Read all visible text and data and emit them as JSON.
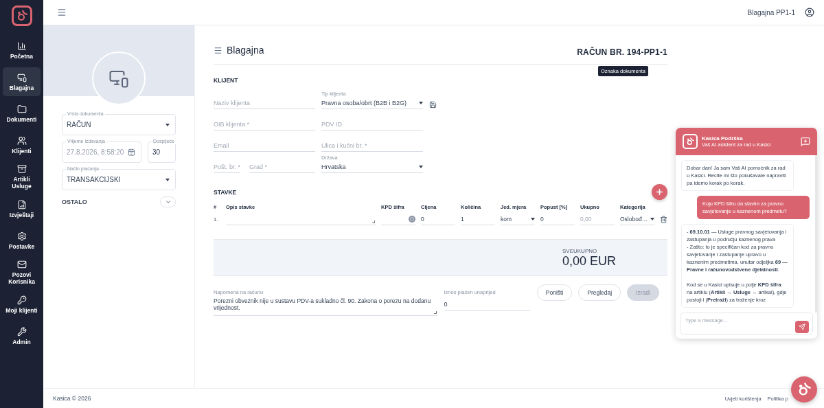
{
  "sidebar": {
    "items": [
      {
        "label": "Početna",
        "selected": false
      },
      {
        "label": "Blagajna",
        "selected": true
      },
      {
        "label": "Dokumenti",
        "selected": false
      },
      {
        "label": "Klijenti",
        "selected": false
      },
      {
        "label": "Artikli\nUsluge",
        "selected": false
      },
      {
        "label": "Izvještaji",
        "selected": false
      },
      {
        "label": "Postavke",
        "selected": false
      },
      {
        "label": "Pozovi\nKorisnika",
        "selected": false
      },
      {
        "label": "Moji klijenti",
        "selected": false
      },
      {
        "label": "Admin",
        "selected": false
      }
    ]
  },
  "top_bar": {
    "user": "Blagajna PP1-1"
  },
  "document_panel": {
    "document_type": {
      "label": "Vrsta dokumenta",
      "value": "RAČUN"
    },
    "issue_time": {
      "label": "Vrijeme izdavanja",
      "value": "27.8.2026, 8:58:20",
      "disabled": true
    },
    "due": {
      "label": "Dospijeće",
      "value": "30"
    },
    "payment_method": {
      "label": "Način plaćanja",
      "value": "TRANSAKCIJSKI"
    },
    "other": {
      "label": "OSTALO",
      "expanded": false
    }
  },
  "page": {
    "title": "Blagajna",
    "document_number": "RAČUN BR. 194-PP1-1",
    "tooltip": "Oznaka dokumenta"
  },
  "client": {
    "title": "KLIJENT",
    "rows": [
      {
        "left": [
          {
            "kind": "input",
            "placeholder": "Naziv klijenta"
          }
        ],
        "right": {
          "kind": "select",
          "label": "Tip klijenta",
          "value": "Pravna osoba/obrt (B2B i B2G)"
        }
      },
      {
        "left": [
          {
            "kind": "input",
            "placeholder": "OIB klijenta *"
          }
        ],
        "right": {
          "kind": "input",
          "placeholder": "PDV ID"
        }
      },
      {
        "left": [
          {
            "kind": "input",
            "placeholder": "Email"
          }
        ],
        "right": {
          "kind": "input",
          "placeholder": "Ulica i kućni br. *"
        }
      },
      {
        "left": [
          {
            "kind": "input",
            "placeholder": "Pošt. br. *"
          },
          {
            "kind": "input",
            "placeholder": "Grad *"
          }
        ],
        "right": {
          "kind": "select",
          "label": "Država",
          "value": "Hrvatska"
        }
      }
    ]
  },
  "items": {
    "title": "STAVKE",
    "columns": [
      "#",
      "Opis stavke",
      "KPD šifra",
      "Cijena",
      "Količina",
      "Jed. mjera",
      "Popust [%]",
      "Ukupno",
      "Kategorija"
    ],
    "rows": [
      {
        "cells": [
          {
            "kind": "number",
            "value": "1."
          },
          {
            "kind": "textarea"
          },
          {
            "kind": "search"
          },
          {
            "kind": "input",
            "value": "0"
          },
          {
            "kind": "input",
            "value": "1"
          },
          {
            "kind": "select",
            "value": "kom"
          },
          {
            "kind": "input",
            "value": "0"
          },
          {
            "kind": "readonly",
            "value": "0,00"
          },
          {
            "kind": "select",
            "value": "Oslobođ…"
          }
        ]
      }
    ]
  },
  "total": {
    "label": "SVEUKUPNO",
    "value": "0,00 EUR"
  },
  "note": {
    "label": "Napomena na računu",
    "value": "Porezni obveznik nije u sustavu PDV-a sukladno čl. 90. Zakona o porezu na dodanu vrijednost."
  },
  "prepaid": {
    "label": "Iznos plaćen unaprijed",
    "value": "0"
  },
  "buttons": [
    {
      "label": "Poništi",
      "disabled": false
    },
    {
      "label": "Pregledaj",
      "disabled": false
    },
    {
      "label": "Izradi",
      "disabled": true
    }
  ],
  "footer": {
    "copyright": "Kasica © 2026",
    "links": [
      "Uvjeti korištenja",
      "Politika p"
    ]
  },
  "chat": {
    "title": "Kasica Podrška",
    "subtitle": "Vaš AI asistent za rad u Kasici",
    "messages": [
      {
        "kind": "assistant",
        "text": "Dobar dan! Ja sam Vaš AI pomoćnik za rad u Kasici. Recite mi što pokušavate napraviti pa idemo korak po korak."
      },
      {
        "kind": "user",
        "text": "Koju KPD šifru da stavim za pravno savjetovanje u kaznenom predmetu?"
      },
      {
        "kind": "assistant",
        "text": "- **69.10.01** — Usluge pravnog savjetovanja i zastupanja u području kaznenog prava\n- Zašto: to je specifičan kod za pravno savjetovanje i zastupanje upravo u kaznenim predmetima, unutar odjeljka **69 — Pravne i računovodstvene djelatnosti**.\n\nKod se u Kasici upisuje u polje **KPD šifra** na artiklu (**Artikli → Usluge** → artikal), gdje postoji i (**Pretraži**) za traženje kroz"
      }
    ],
    "input": {
      "placeholder": "Type a message..."
    }
  }
}
